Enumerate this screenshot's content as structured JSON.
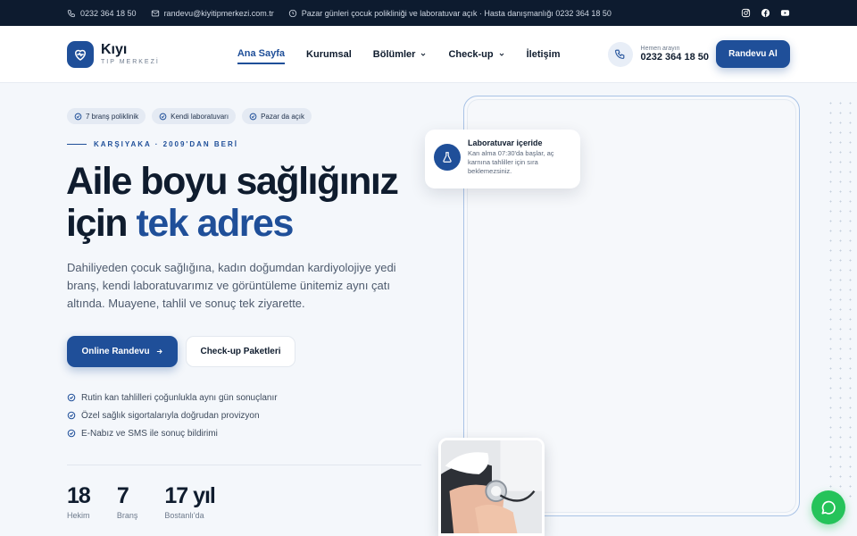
{
  "topbar": {
    "phone": "0232 364 18 50",
    "email": "randevu@kiyitipmerkezi.com.tr",
    "notice": "Pazar günleri çocuk polikliniği ve laboratuvar açık · Hasta danışmanlığı 0232 364 18 50",
    "social": [
      "instagram-icon",
      "facebook-icon",
      "youtube-icon"
    ]
  },
  "header": {
    "logo_name": "Kıyı",
    "logo_sub": "TIP MERKEZİ",
    "nav": [
      "Ana Sayfa",
      "Kurumsal",
      "Bölümler",
      "Check-up",
      "İletişim"
    ],
    "call_label": "Hemen arayın",
    "call_number": "0232 364 18 50",
    "cta": "Randevu Al"
  },
  "hero": {
    "chips": [
      "7 branş poliklinik",
      "Kendi laboratuvarı",
      "Pazar da açık"
    ],
    "eyebrow": "KARŞIYAKA · 2009'DAN BERİ",
    "title_line1": "Aile boyu sağlığınız",
    "title_line2_plain": "için ",
    "title_line2_accent": "tek adres",
    "description": "Dahiliyeden çocuk sağlığına, kadın doğumdan kardiyolojiye yedi branş, kendi laboratuvarımız ve görüntüleme ünitemiz aynı çatı altında. Muayene, tahlil ve sonuç tek ziyarette.",
    "primary_button": "Online Randevu",
    "secondary_button": "Check-up Paketleri",
    "checks": [
      "Rutin kan tahlilleri çoğunlukla aynı gün sonuçlanır",
      "Özel sağlık sigortalarıyla doğrudan provizyon",
      "E-Nabız ve SMS ile sonuç bildirimi"
    ],
    "stats": [
      {
        "value": "18",
        "label": "Hekim"
      },
      {
        "value": "7",
        "label": "Branş"
      },
      {
        "value": "17 yıl",
        "label": "Bostanlı'da"
      }
    ]
  },
  "lab_card": {
    "title": "Laboratuvar içeride",
    "description": "Kan alma 07:30'da başlar, aç karnına tahliller için sıra beklemezsiniz."
  },
  "colors": {
    "brand": "#1f4f99",
    "dark": "#0d1b2f",
    "whatsapp": "#25c35a"
  }
}
